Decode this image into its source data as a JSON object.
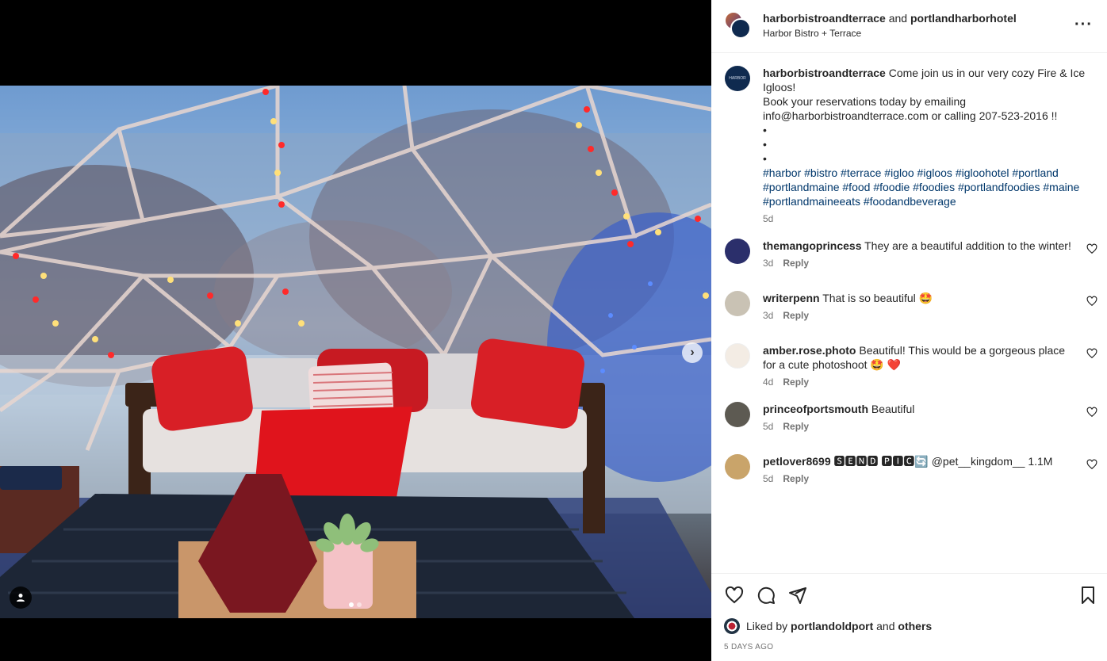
{
  "header": {
    "author": "harborbistroandterrace",
    "connector": " and ",
    "collaborator": "portlandharborhotel",
    "location": "Harbor Bistro + Terrace",
    "more_icon": "more-horizontal-icon"
  },
  "caption": {
    "username": "harborbistroandterrace",
    "line1": " Come join us in our very cozy Fire & Ice Igloos!",
    "line2": "Book your reservations today by emailing info@harborbistroandterrace.com or calling 207-523-2016 !!",
    "bullets": [
      "•",
      "•",
      "•"
    ],
    "hashtags": "#harbor #bistro #terrace #igloo #igloos #igloohotel #portland #portlandmaine #food #foodie #foodies #portlandfoodies #maine #portlandmaineeats #foodandbeverage",
    "time": "5d"
  },
  "comments": [
    {
      "username": "themangoprincess",
      "text": " They are a beautiful addition to the winter!",
      "time": "3d",
      "reply": "Reply",
      "avatar_color": "#2b2f6b"
    },
    {
      "username": "writerpenn",
      "text": " That is so beautiful 🤩",
      "time": "3d",
      "reply": "Reply",
      "avatar_color": "#c9c2b4"
    },
    {
      "username": "amber.rose.photo",
      "text": " Beautiful! This would be a gorgeous place for a cute photoshoot 🤩 ❤️",
      "time": "4d",
      "reply": "Reply",
      "avatar_color": "#f3ece4"
    },
    {
      "username": "princeofportsmouth",
      "text": " Beautiful",
      "time": "5d",
      "reply": "Reply",
      "avatar_color": "#5d5a52"
    },
    {
      "username": "petlover8699",
      "text": " 🆂🅴🅽🅳 🅿🅸🅲🔄 @pet__kingdom__ 1.1M",
      "time": "5d",
      "reply": "Reply",
      "avatar_color": "#c9a46a"
    }
  ],
  "likes": {
    "prefix": "Liked by ",
    "user": "portlandoldport",
    "middle": " and ",
    "others": "others"
  },
  "timestamp": "5 DAYS AGO",
  "carousel": {
    "current": 1,
    "total": 2
  }
}
